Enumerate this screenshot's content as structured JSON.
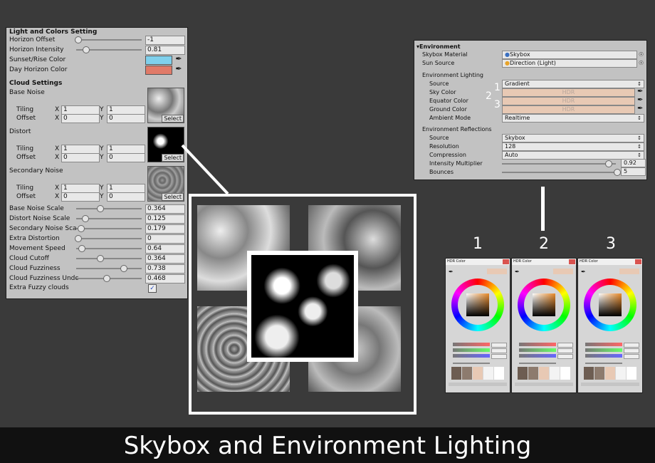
{
  "left_panel": {
    "section_light": "Light and Colors Setting",
    "horizon_offset_label": "Horizon Offset",
    "horizon_offset_value": "-1",
    "horizon_intensity_label": "Horizon Intensity",
    "horizon_intensity_value": "0.81",
    "sunset_color_label": "Sunset/Rise Color",
    "sunset_color": "#7fd0ec",
    "day_horizon_label": "Day Horizon Color",
    "day_horizon_color": "#e07a68",
    "section_cloud": "Cloud Settings",
    "tiling_label": "Tiling",
    "offset_label": "Offset",
    "x_label": "X",
    "y_label": "Y",
    "select_label": "Select",
    "textures": [
      {
        "name": "Base Noise",
        "tiling_x": "1",
        "tiling_y": "1",
        "offset_x": "0",
        "offset_y": "0"
      },
      {
        "name": "Distort",
        "tiling_x": "1",
        "tiling_y": "1",
        "offset_x": "0",
        "offset_y": "0"
      },
      {
        "name": "Secondary Noise",
        "tiling_x": "1",
        "tiling_y": "1",
        "offset_x": "0",
        "offset_y": "0"
      }
    ],
    "sliders": [
      {
        "label": "Base Noise Scale",
        "value": "0.364",
        "fraction": 0.36
      },
      {
        "label": "Distort Noise Scale",
        "value": "0.125",
        "fraction": 0.12
      },
      {
        "label": "Secondary Noise Sca",
        "value": "0.179",
        "fraction": 0.05
      },
      {
        "label": "Extra Distortion",
        "value": "0",
        "fraction": 0.0
      },
      {
        "label": "Movement Speed",
        "value": "0.64",
        "fraction": 0.06
      },
      {
        "label": "Cloud Cutoff",
        "value": "0.364",
        "fraction": 0.36
      },
      {
        "label": "Cloud Fuzziness",
        "value": "0.738",
        "fraction": 0.74
      },
      {
        "label": "Cloud Fuzziness Undc",
        "value": "0.468",
        "fraction": 0.47
      }
    ],
    "extra_fuzzy_label": "Extra Fuzzy clouds",
    "extra_fuzzy_checked": true
  },
  "environment": {
    "header": "Environment",
    "skybox_material_label": "Skybox Material",
    "skybox_material_value": "Skybox",
    "sun_source_label": "Sun Source",
    "sun_source_value": "Direction (Light)",
    "lighting_header": "Environment Lighting",
    "source_label": "Source",
    "source_value": "Gradient",
    "sky_color_label": "Sky Color",
    "equator_color_label": "Equator Color",
    "ground_color_label": "Ground Color",
    "hdr_text": "HDR",
    "ambient_mode_label": "Ambient Mode",
    "ambient_mode_value": "Realtime",
    "reflections_header": "Environment Reflections",
    "refl_source_label": "Source",
    "refl_source_value": "Skybox",
    "resolution_label": "Resolution",
    "resolution_value": "128",
    "compression_label": "Compression",
    "compression_value": "Auto",
    "intensity_label": "Intensity Multiplier",
    "intensity_value": "0.92",
    "bounces_label": "Bounces",
    "bounces_value": "5"
  },
  "marker_numbers": [
    "1",
    "2",
    "3"
  ],
  "hdr_windows": [
    {
      "number": "1",
      "title": "HDR Color"
    },
    {
      "number": "2",
      "title": "HDR Color"
    },
    {
      "number": "3",
      "title": "HDR Color"
    }
  ],
  "caption": "Skybox and Environment Lighting"
}
